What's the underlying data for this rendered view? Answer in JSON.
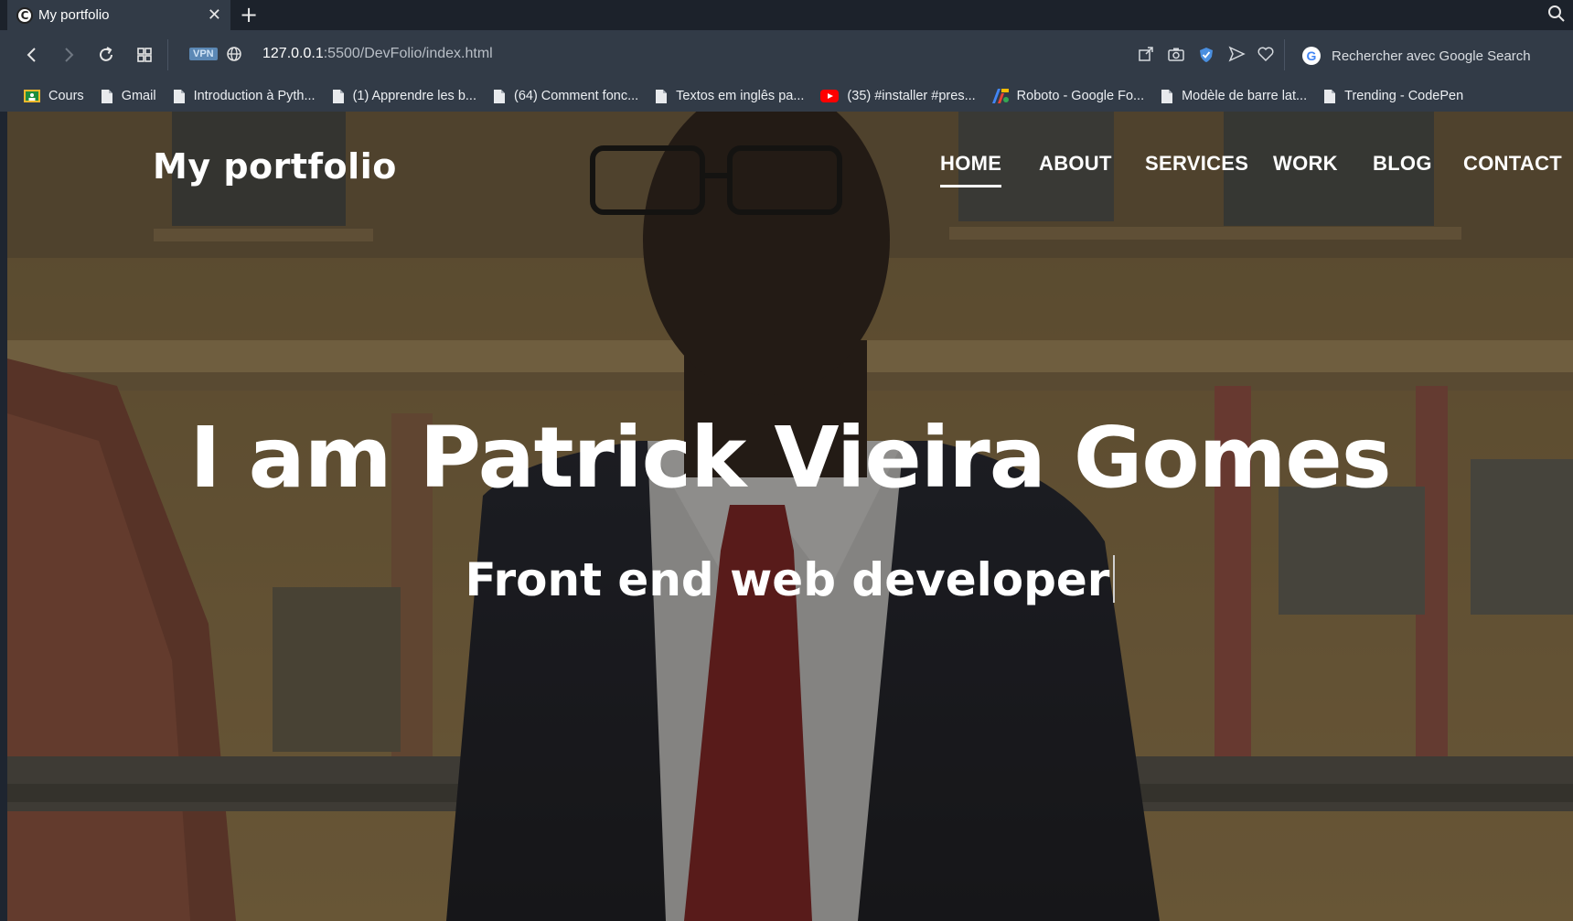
{
  "browser": {
    "tab": {
      "title": "My portfolio",
      "favicon_icon": "site-favicon-icon"
    },
    "address": {
      "vpn_label": "VPN",
      "url_host": "127.0.0.1",
      "url_path": ":5500/DevFolio/index.html"
    },
    "search": {
      "placeholder": "Rechercher avec Google Search",
      "engine_glyph": "G"
    },
    "bookmarks": [
      {
        "label": "Cours",
        "icon": "classroom-icon"
      },
      {
        "label": "Gmail",
        "icon": "page-icon"
      },
      {
        "label": "Introduction à Pyth...",
        "icon": "page-icon"
      },
      {
        "label": "(1) Apprendre les b...",
        "icon": "page-icon"
      },
      {
        "label": "(64) Comment fonc...",
        "icon": "page-icon"
      },
      {
        "label": "Textos em inglês pa...",
        "icon": "page-icon"
      },
      {
        "label": "(35) #installer #pres...",
        "icon": "youtube-icon"
      },
      {
        "label": "Roboto - Google Fo...",
        "icon": "google-fonts-icon"
      },
      {
        "label": "Modèle de barre lat...",
        "icon": "page-icon"
      },
      {
        "label": "Trending - CodePen",
        "icon": "page-icon"
      }
    ]
  },
  "site": {
    "logo": "My portfolio",
    "nav": [
      "HOME",
      "ABOUT",
      "SERVICES",
      "WORK",
      "BLOG",
      "CONTACT"
    ],
    "active_nav": "HOME",
    "hero": {
      "title": "I am Patrick Vieira Gomes",
      "subtitle": "Front end web developer"
    }
  }
}
